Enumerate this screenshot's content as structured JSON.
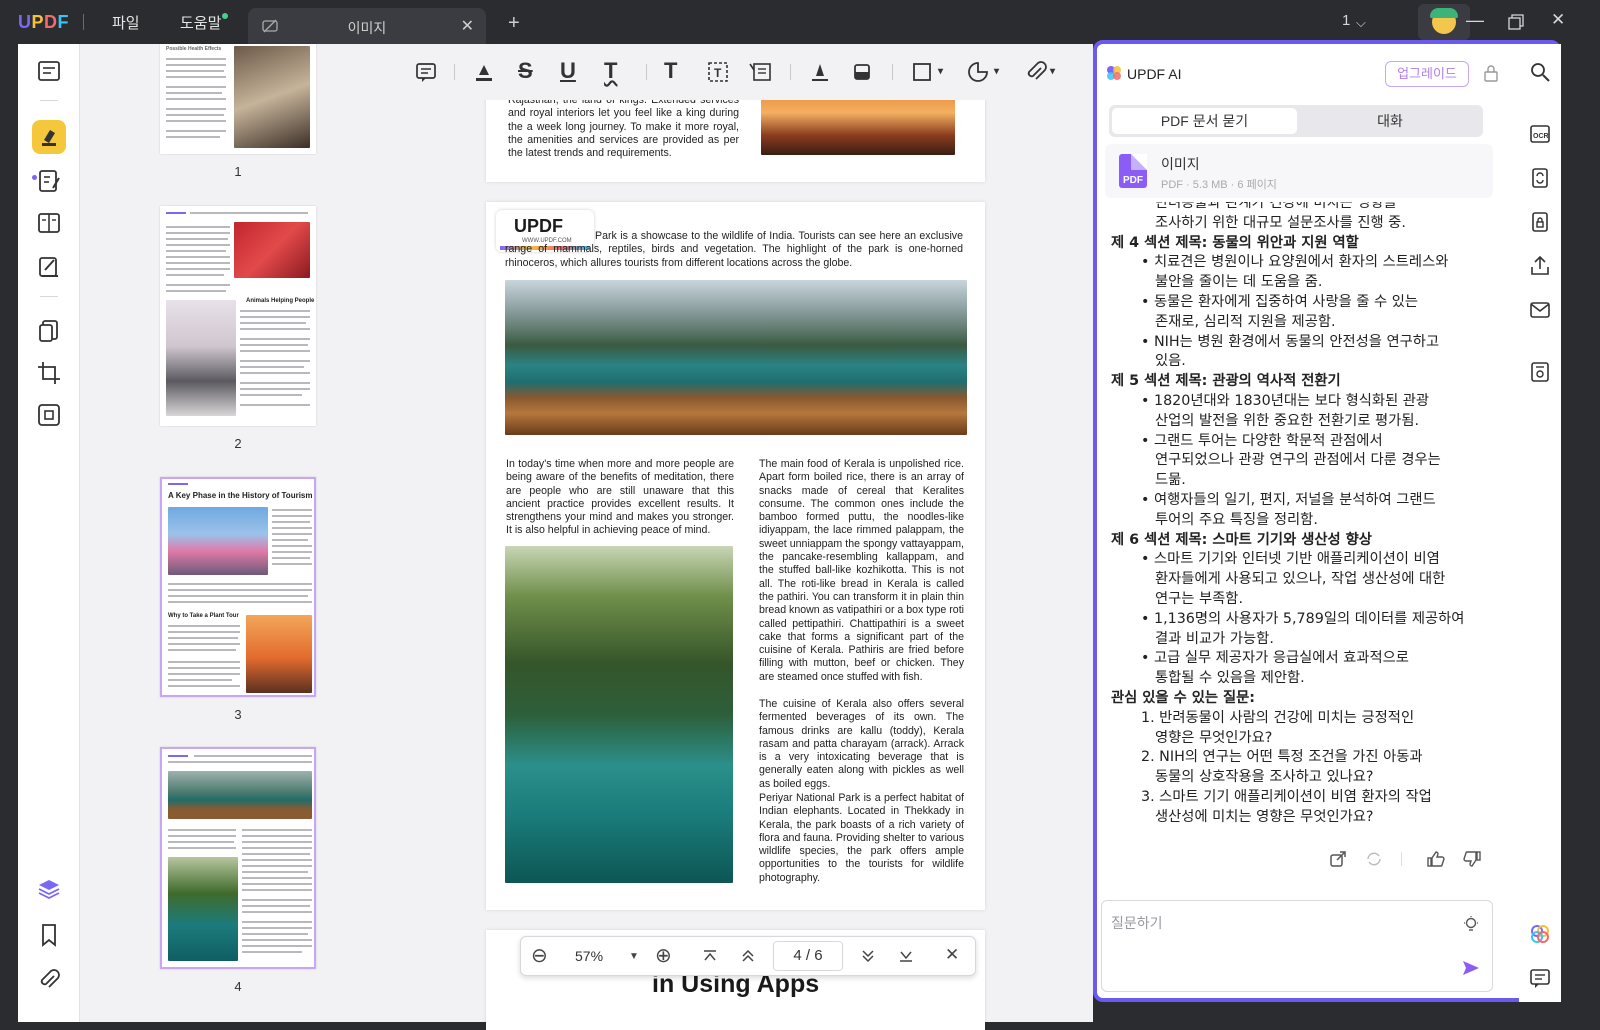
{
  "app": {
    "logo": "UPDF"
  },
  "menu": {
    "file": "파일",
    "help": "도움말"
  },
  "tab": {
    "title": "이미지"
  },
  "window": {
    "user_count": "1"
  },
  "thumbnails": [
    {
      "label": "1",
      "head": "Possible Health Effects"
    },
    {
      "label": "2",
      "head": "Animals Helping People"
    },
    {
      "label": "3",
      "head": "A Key Phase in the History of Tourism",
      "subhead": "Why to Take a Plant Tour"
    },
    {
      "label": "4"
    }
  ],
  "document": {
    "page3_tail": "Rajasthan, the land of kings. Extended services and royal interiors let you feel like a king during the a week long journey. To make it more royal, the amenities and services are provided as per the latest trends and requirements.",
    "logo_text": "UPDF",
    "logo_url": "WWW.UPDF.COM",
    "intro": "Park is a showcase to the wildlife of India. Tourists can see here an exclusive range of mammals, reptiles, birds and vegetation. The highlight of the park is one-horned rhinoceros, which allures tourists from different locations across the globe.",
    "meditation": "In today's time when more and more people are being aware of the benefits of meditation, there are people who are still unaware that this ancient practice provides excellent results. It strengthens your mind and makes you stronger. It is also helpful in achieving peace of mind.",
    "food": "The main food of Kerala is unpolished rice. Apart form boiled rice, there is an array of snacks made of cereal that Keralites consume. The common ones include the bamboo formed puttu, the noodles-like idiyappam, the lace rimmed palappam, the sweet unniappam the spongy vattayappam, the pancake-resembling kallappam, and the stuffed ball-like kozhikotta. This is not all. The roti-like bread in Kerala is called the pathiri. You can transform it in plain thin bread known as vatipathiri or a box type roti called pettipathiri. Chattipathiri is a sweet cake that forms a significant part of the cuisine of Kerala. Pathiris are fried before filling with mutton, beef or chicken. They are steamed once stuffed with fish.",
    "beverages": "The cuisine of Kerala also offers several fermented beverages of its own. The famous drinks are kallu (toddy), Kerala rasam and patta charayam (arrack). Arrack is a very intoxicating beverage that is generally eaten along with pickles as well as boiled eggs.",
    "periyar": "Periyar National Park is a perfect habitat of Indian elephants. Located in Thekkady in Kerala, the park boasts of a rich variety of flora and fauna. Providing shelter to various wildlife species, the park offers ample opportunities to the tourists for wildlife photography.",
    "next_title": "in Using Apps"
  },
  "zoombar": {
    "zoom": "57%",
    "page_current": "4",
    "page_sep": "/",
    "page_total": "6"
  },
  "ai": {
    "title": "UPDF AI",
    "upgrade": "업그레이드",
    "tab_pdf": "PDF 문서 묻기",
    "tab_chat": "대화",
    "file_name": "이미지",
    "file_meta": "PDF · 5.3 MB · 6 페이지",
    "lines": [
      {
        "text": "반려동물과 관계가 건강에 미치는 영향을",
        "indent": 2,
        "h": false
      },
      {
        "text": "조사하기 위한 대규모 설문조사를 진행 중.",
        "indent": 2,
        "h": false
      },
      {
        "text": "제 4 섹션 제목: 동물의 위안과 지원 역할",
        "indent": 0,
        "h": true
      },
      {
        "text": "• 치료견은 병원이나 요양원에서 환자의 스트레스와",
        "indent": 1,
        "h": false
      },
      {
        "text": "불안을 줄이는 데 도움을 줌.",
        "indent": 2,
        "h": false
      },
      {
        "text": "• 동물은 환자에게 집중하여 사랑을 줄 수 있는",
        "indent": 1,
        "h": false
      },
      {
        "text": "존재로, 심리적 지원을 제공함.",
        "indent": 2,
        "h": false
      },
      {
        "text": "• NIH는 병원 환경에서 동물의 안전성을 연구하고",
        "indent": 1,
        "h": false
      },
      {
        "text": "있음.",
        "indent": 2,
        "h": false
      },
      {
        "text": "제 5 섹션 제목: 관광의 역사적 전환기",
        "indent": 0,
        "h": true
      },
      {
        "text": "• 1820년대와 1830년대는 보다 형식화된 관광",
        "indent": 1,
        "h": false
      },
      {
        "text": "산업의 발전을 위한 중요한 전환기로 평가됨.",
        "indent": 2,
        "h": false
      },
      {
        "text": "• 그랜드 투어는 다양한 학문적 관점에서",
        "indent": 1,
        "h": false
      },
      {
        "text": "연구되었으나 관광 연구의 관점에서 다룬 경우는",
        "indent": 2,
        "h": false
      },
      {
        "text": "드묾.",
        "indent": 2,
        "h": false
      },
      {
        "text": "• 여행자들의 일기, 편지, 저널을 분석하여 그랜드",
        "indent": 1,
        "h": false
      },
      {
        "text": "투어의 주요 특징을 정리함.",
        "indent": 2,
        "h": false
      },
      {
        "text": "제 6 섹션 제목: 스마트 기기와 생산성 향상",
        "indent": 0,
        "h": true
      },
      {
        "text": "• 스마트 기기와 인터넷 기반 애플리케이션이 비염",
        "indent": 1,
        "h": false
      },
      {
        "text": "환자들에게 사용되고 있으나, 작업 생산성에 대한",
        "indent": 2,
        "h": false
      },
      {
        "text": "연구는 부족함.",
        "indent": 2,
        "h": false
      },
      {
        "text": "• 1,136명의 사용자가 5,789일의 데이터를 제공하여",
        "indent": 1,
        "h": false
      },
      {
        "text": "결과 비교가 가능함.",
        "indent": 2,
        "h": false
      },
      {
        "text": "• 고급 실무 제공자가 응급실에서 효과적으로",
        "indent": 1,
        "h": false
      },
      {
        "text": "통합될 수 있음을 제안함.",
        "indent": 2,
        "h": false
      },
      {
        "text": "관심 있을 수 있는 질문:",
        "indent": 0,
        "h": true
      },
      {
        "text": "1. 반려동물이 사람의 건강에 미치는 긍정적인",
        "indent": 1,
        "h": false
      },
      {
        "text": "영향은 무엇인가요?",
        "indent": 2,
        "h": false
      },
      {
        "text": "2. NIH의 연구는 어떤 특정 조건을 가진 아동과",
        "indent": 1,
        "h": false
      },
      {
        "text": "동물의 상호작용을 조사하고 있나요?",
        "indent": 2,
        "h": false
      },
      {
        "text": "3. 스마트 기기 애플리케이션이 비염 환자의 작업",
        "indent": 1,
        "h": false
      },
      {
        "text": "생산성에 미치는 영향은 무엇인가요?",
        "indent": 2,
        "h": false
      }
    ],
    "input_placeholder": "질문하기"
  },
  "colors": {
    "accent": "#6a5af0",
    "highlight_tool": "#f4c83a",
    "upgrade": "#b07ef0"
  }
}
